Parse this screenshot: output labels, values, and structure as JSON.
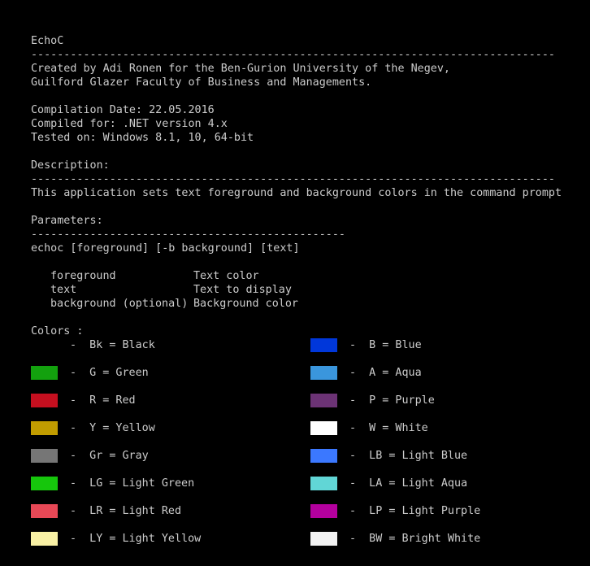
{
  "header": {
    "app_name": "EchoC",
    "rule_long": "--------------------------------------------------------------------------------",
    "credit_line1": "Created by Adi Ronen for the Ben-Gurion University of the Negev,",
    "credit_line2": "Guilford Glazer Faculty of Business and Managements."
  },
  "build": {
    "compilation_date": "Compilation Date: 22.05.2016",
    "compiled_for": "Compiled for: .NET version 4.x",
    "tested_on": "Tested on: Windows 8.1, 10, 64-bit"
  },
  "description": {
    "heading": "Description:",
    "rule": "--------------------------------------------------------------------------------",
    "text": "This application sets text foreground and background colors in the command prompt"
  },
  "parameters": {
    "heading": "Parameters:",
    "rule": "------------------------------------------------",
    "usage": "echoc [foreground] [-b background] [text]",
    "items": [
      {
        "name": "foreground",
        "desc": "Text color"
      },
      {
        "name": "text",
        "desc": "Text to display"
      },
      {
        "name": "background (optional)",
        "desc": "Background color"
      }
    ]
  },
  "colors": {
    "heading": "Colors :",
    "left": [
      {
        "label": "-  Bk = Black",
        "hex": "#000000"
      },
      {
        "label": "-  G = Green",
        "hex": "#13a10e"
      },
      {
        "label": "-  R = Red",
        "hex": "#c50f1f"
      },
      {
        "label": "-  Y = Yellow",
        "hex": "#c19c00"
      },
      {
        "label": "-  Gr = Gray",
        "hex": "#767676"
      },
      {
        "label": "-  LG = Light Green",
        "hex": "#16c60c"
      },
      {
        "label": "-  LR = Light Red",
        "hex": "#e74856"
      },
      {
        "label": "-  LY = Light Yellow",
        "hex": "#f9f1a5"
      }
    ],
    "right": [
      {
        "label": "-  B = Blue",
        "hex": "#0037da"
      },
      {
        "label": "-  A = Aqua",
        "hex": "#3a96dd"
      },
      {
        "label": "-  P = Purple",
        "hex": "#6c3375"
      },
      {
        "label": "-  W = White",
        "hex": "#ffffff"
      },
      {
        "label": "-  LB = Light Blue",
        "hex": "#3b78ff"
      },
      {
        "label": "-  LA = Light Aqua",
        "hex": "#61d6d6"
      },
      {
        "label": "-  LP = Light Purple",
        "hex": "#b4009e"
      },
      {
        "label": "-  BW = Bright White",
        "hex": "#f2f2f2"
      }
    ]
  }
}
